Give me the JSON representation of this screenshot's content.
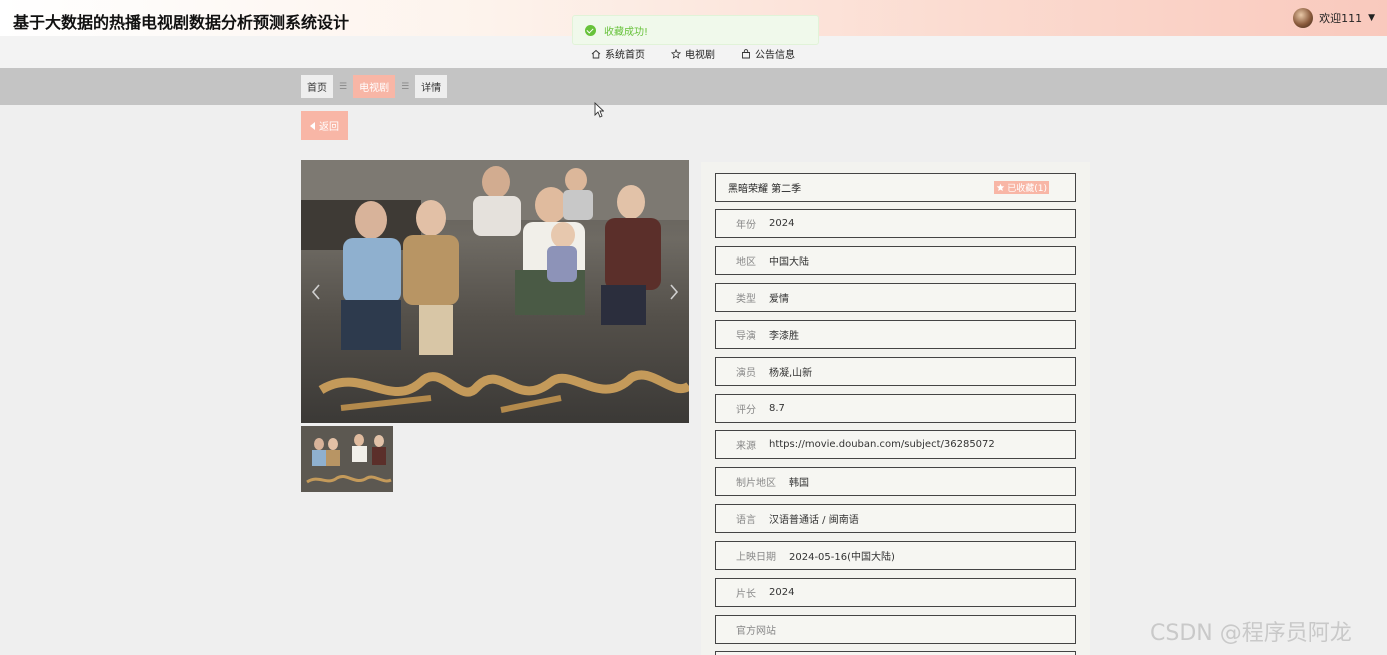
{
  "header": {
    "title": "基于大数据的热播电视剧数据分析预测系统设计",
    "welcome": "欢迎111",
    "caret": "▼"
  },
  "toast": {
    "text": "收藏成功!"
  },
  "nav": [
    {
      "label": "系统首页",
      "icon": "home-icon"
    },
    {
      "label": "电视剧",
      "icon": "star-icon"
    },
    {
      "label": "公告信息",
      "icon": "bag-icon"
    }
  ],
  "breadcrumb": {
    "items": [
      "首页",
      "电视剧",
      "详情"
    ],
    "separator": "☰",
    "active_index": 1
  },
  "back_button": {
    "label": "返回"
  },
  "detail": {
    "title": "黑暗荣耀 第二季",
    "favorite_badge": "已收藏(1)",
    "fields": [
      {
        "label": "年份",
        "value": "2024"
      },
      {
        "label": "地区",
        "value": "中国大陆"
      },
      {
        "label": "类型",
        "value": "爱情"
      },
      {
        "label": "导演",
        "value": "李漆胜"
      },
      {
        "label": "演员",
        "value": "杨凝,山新"
      },
      {
        "label": "评分",
        "value": "8.7"
      },
      {
        "label": "来源",
        "value": "https://movie.douban.com/subject/36285072"
      },
      {
        "label": "制片地区",
        "value": "韩国"
      },
      {
        "label": "语言",
        "value": "汉语普通话 / 闽南语"
      },
      {
        "label": "上映日期",
        "value": "2024-05-16(中国大陆)"
      },
      {
        "label": "片长",
        "value": "2024"
      },
      {
        "label": "官方网站",
        "value": ""
      }
    ]
  },
  "watermark": "CSDN @程序员阿龙",
  "colors": {
    "accent": "#f8b6a6",
    "success": "#67c23a",
    "breadcrumb_band": "#c4c4c4"
  }
}
